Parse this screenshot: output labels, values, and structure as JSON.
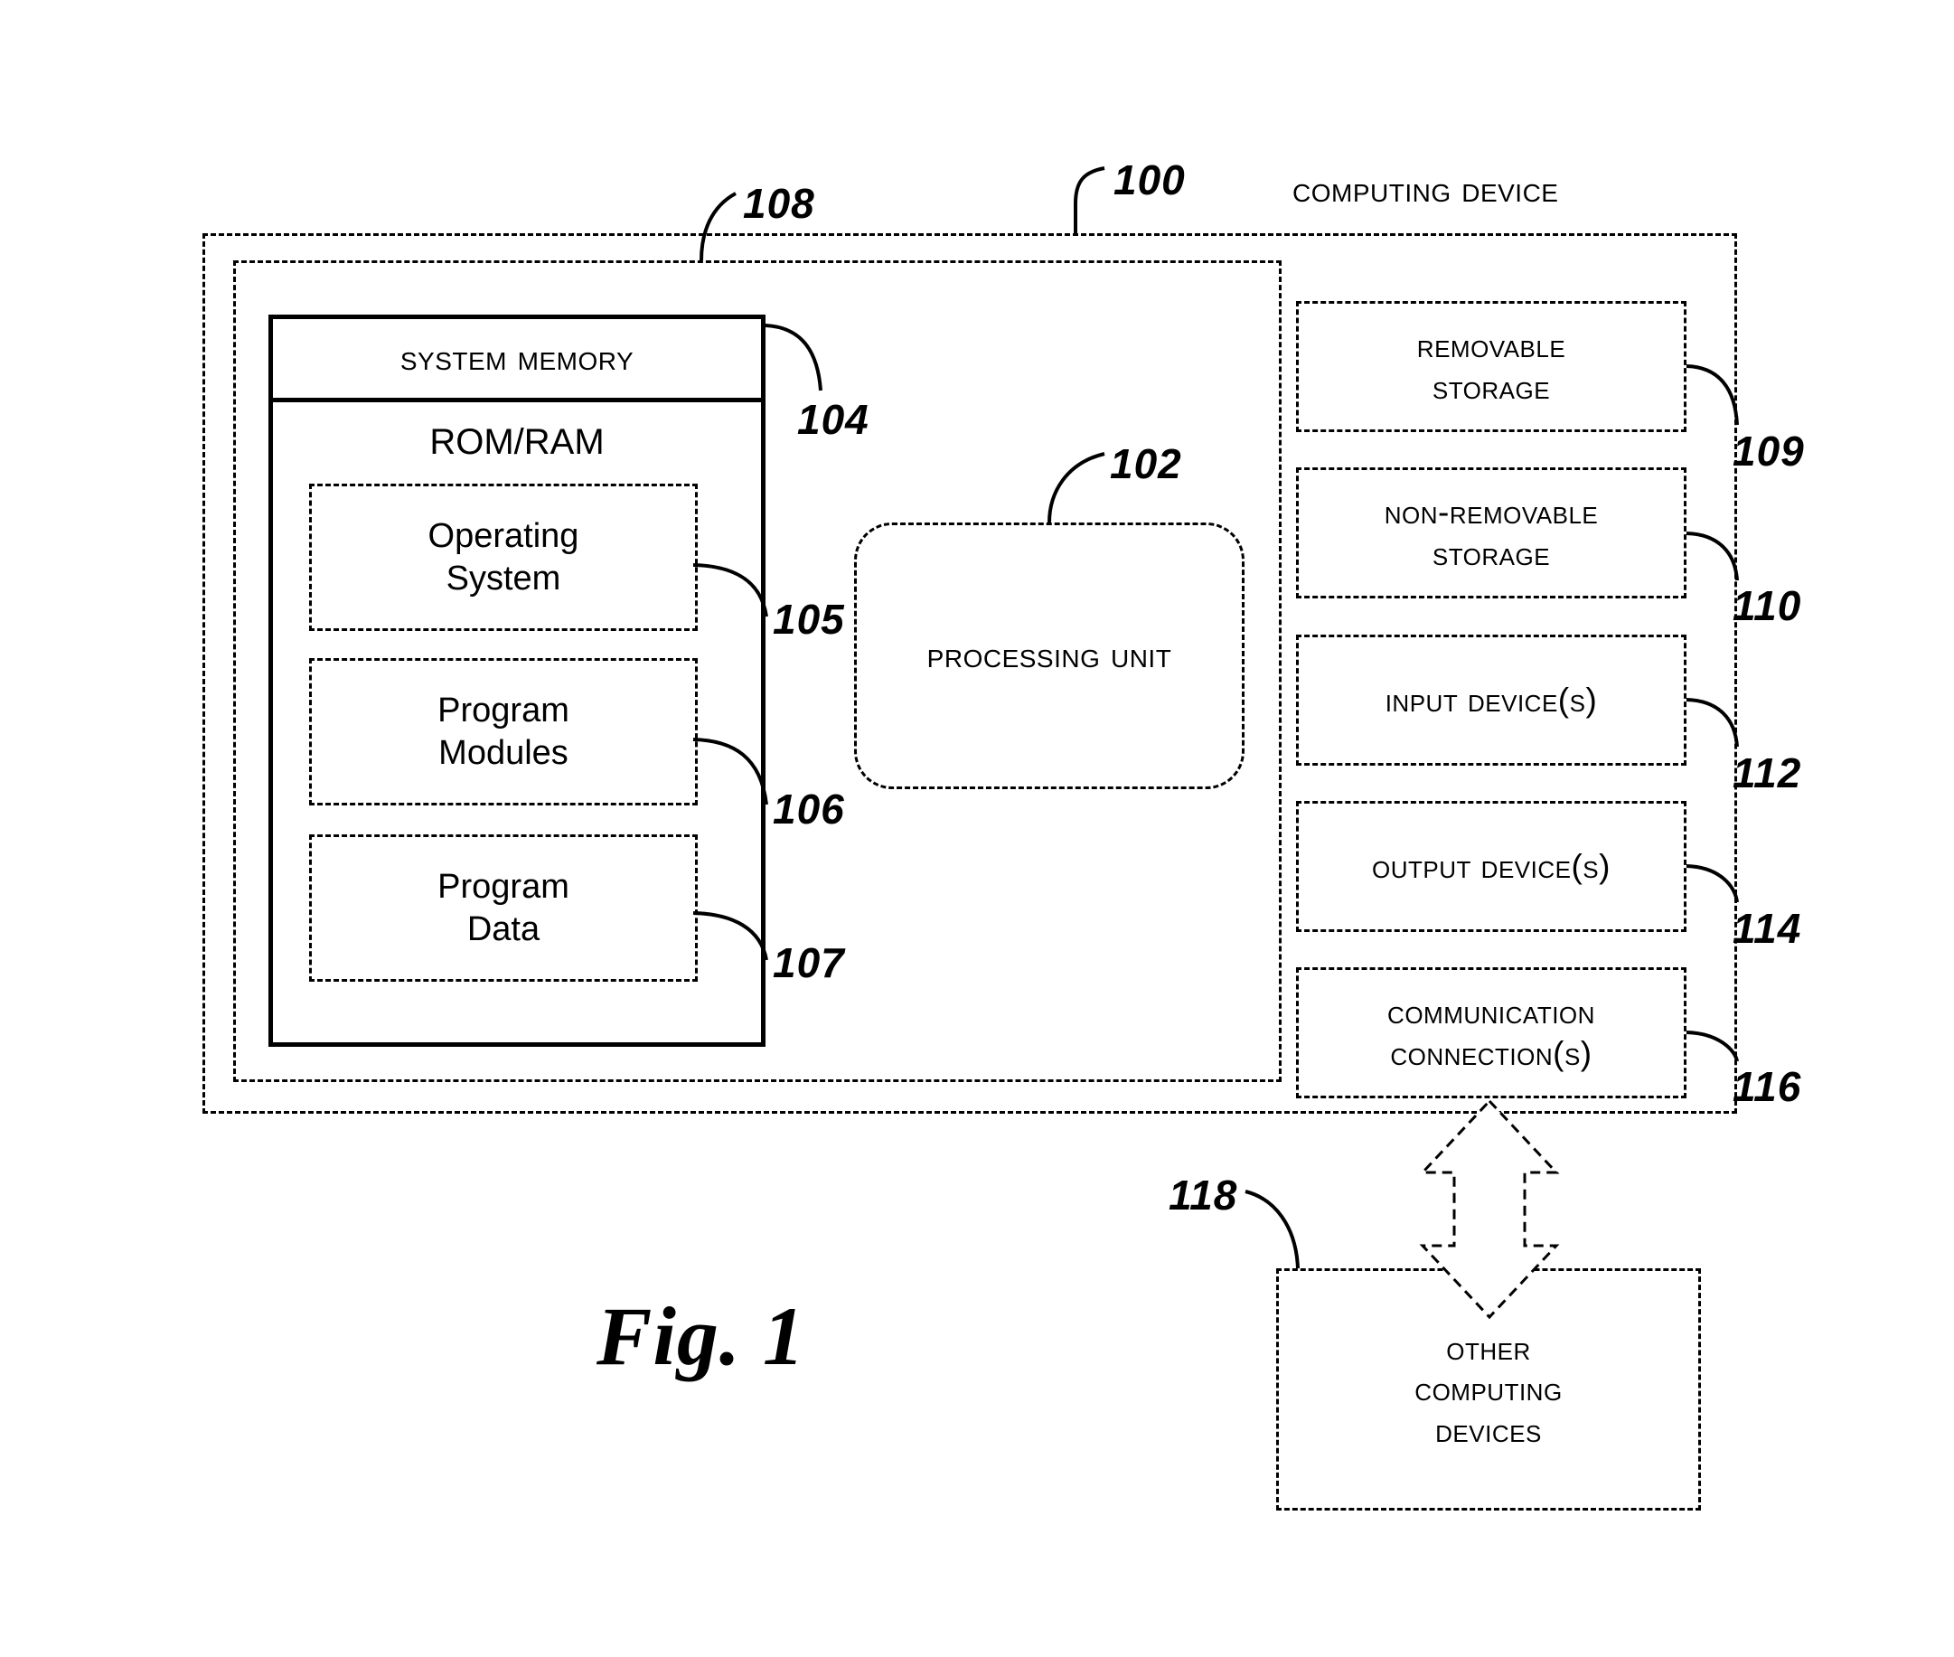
{
  "figure": {
    "caption": "Fig. 1",
    "device_title": "Computing Device"
  },
  "frames": {
    "outer_ref": "100",
    "inner_ref": "108"
  },
  "memory": {
    "header": "System Memory",
    "header_ref": "104",
    "type_label": "ROM/RAM",
    "items": [
      {
        "line1": "Operating",
        "line2": "System",
        "ref": "105"
      },
      {
        "line1": "Program",
        "line2": "Modules",
        "ref": "106"
      },
      {
        "line1": "Program",
        "line2": "Data",
        "ref": "107"
      }
    ]
  },
  "processing": {
    "label": "Processing Unit",
    "ref": "102"
  },
  "peripherals": [
    {
      "line1": "Removable",
      "line2": "Storage",
      "ref": "109"
    },
    {
      "line1": "Non-Removable",
      "line2": "Storage",
      "ref": "110"
    },
    {
      "line1": "Input Device(s)",
      "line2": "",
      "ref": "112"
    },
    {
      "line1": "Output Device(s)",
      "line2": "",
      "ref": "114"
    },
    {
      "line1": "Communication",
      "line2": "Connection(s)",
      "ref": "116"
    }
  ],
  "other_devices": {
    "line1": "Other",
    "line2": "Computing",
    "line3": "Devices",
    "ref": "118"
  },
  "colors": {
    "ink": "#000000",
    "paper": "#ffffff"
  }
}
